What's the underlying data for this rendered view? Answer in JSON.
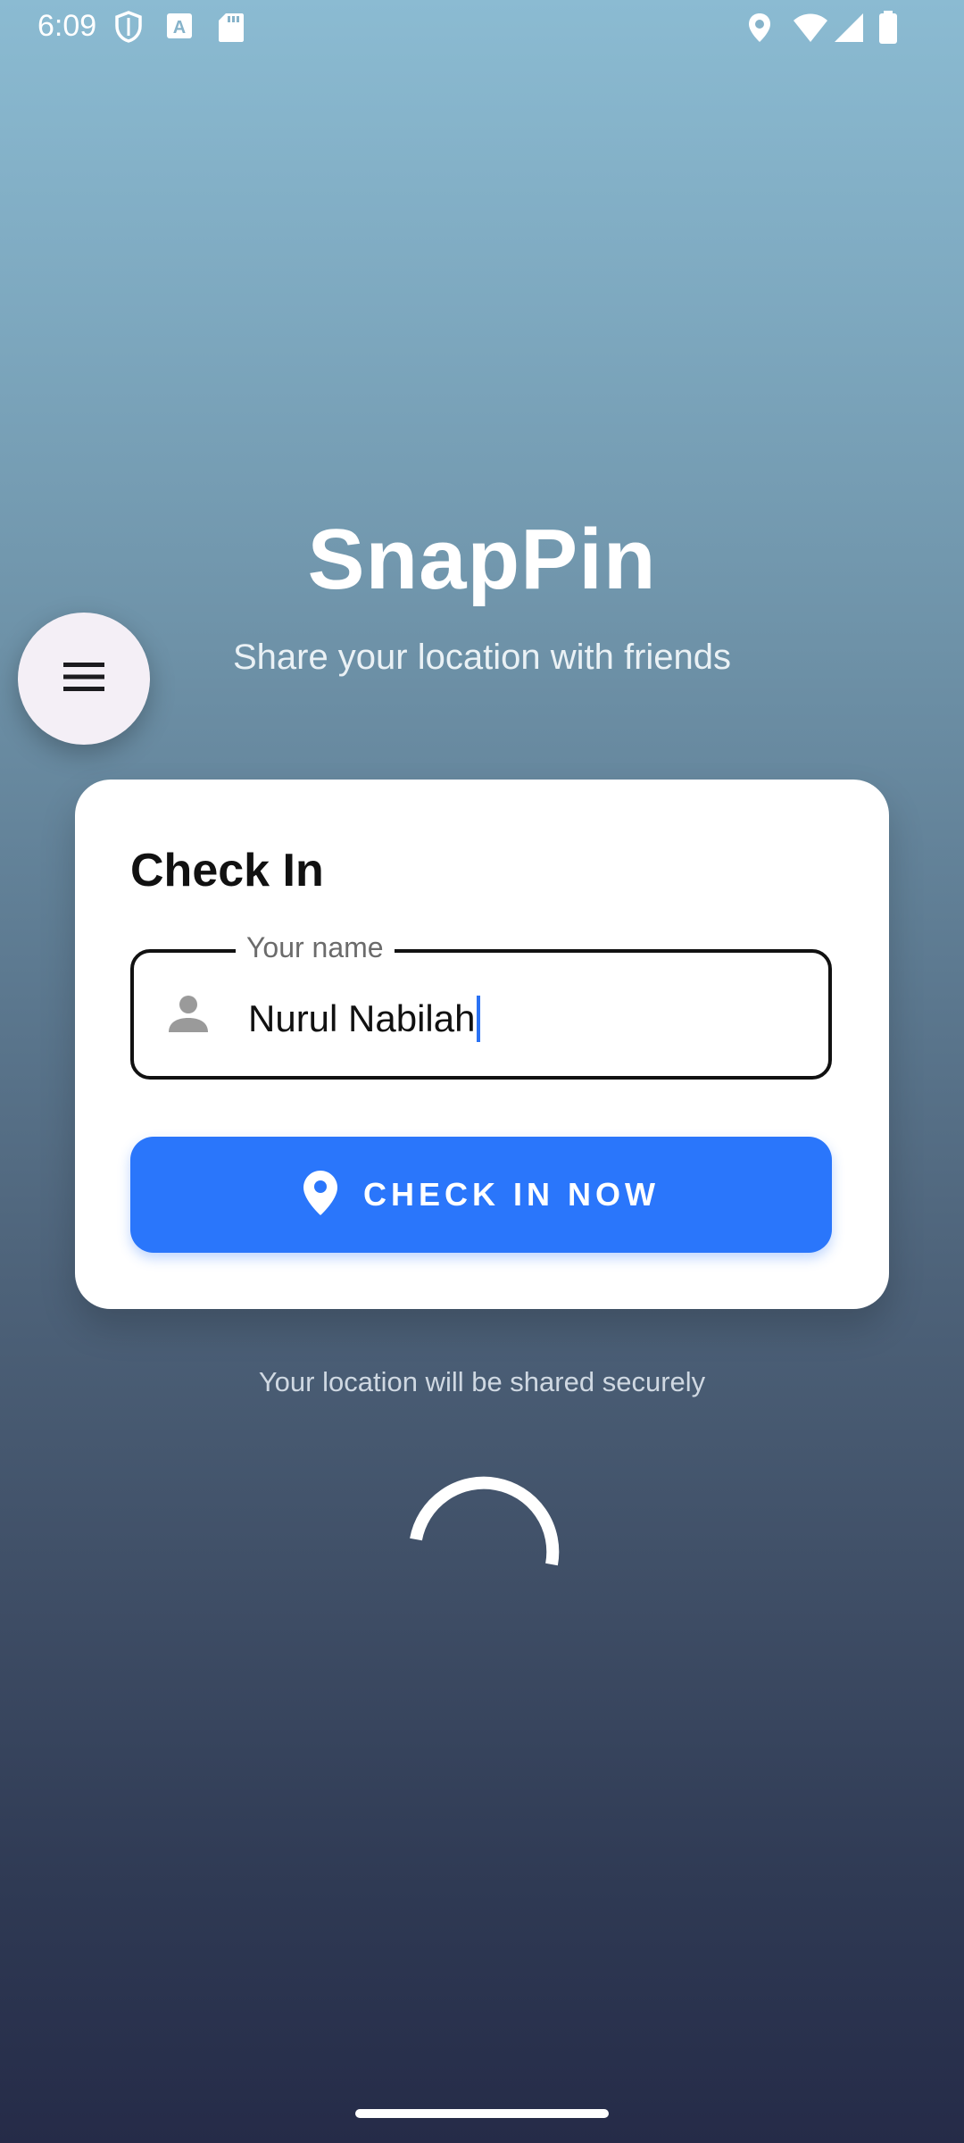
{
  "status_bar": {
    "time": "6:09",
    "left_icons": [
      "shield-icon",
      "text-a-icon",
      "sd-card-icon"
    ],
    "right_icons": [
      "location-icon",
      "wifi-icon",
      "signal-icon",
      "battery-icon"
    ]
  },
  "app": {
    "title": "SnapPin",
    "subtitle": "Share your location with friends"
  },
  "menu": {
    "icon": "menu-icon"
  },
  "card": {
    "title": "Check In",
    "name_field": {
      "label": "Your name",
      "value": "Nurul Nabilah",
      "icon": "person-icon"
    },
    "button": {
      "label": "CHECK IN NOW",
      "icon": "location-pin-icon"
    }
  },
  "footer_note": "Your location will be shared securely",
  "colors": {
    "accent": "#2A76FB",
    "card_background": "#FFFFFF",
    "gradient_top": "#8BBBD2",
    "gradient_bottom": "#252B48"
  }
}
